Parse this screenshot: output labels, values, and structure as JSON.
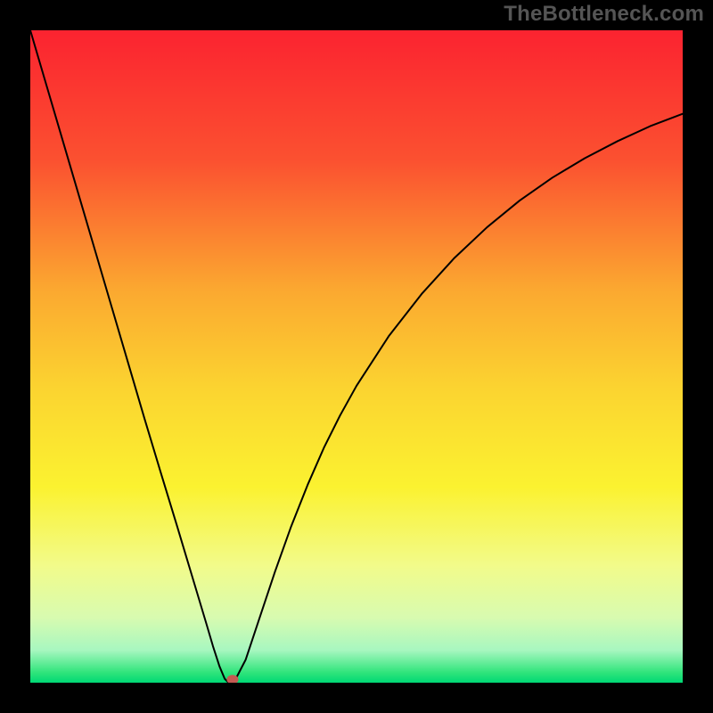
{
  "watermark": "TheBottleneck.com",
  "chart_data": {
    "type": "line",
    "title": "",
    "xlabel": "",
    "ylabel": "",
    "xlim": [
      0,
      100
    ],
    "ylim": [
      0,
      100
    ],
    "background_gradient": {
      "stops": [
        {
          "offset": 0.0,
          "color": "#fb2330"
        },
        {
          "offset": 0.2,
          "color": "#fb5130"
        },
        {
          "offset": 0.4,
          "color": "#fba930"
        },
        {
          "offset": 0.55,
          "color": "#fbd430"
        },
        {
          "offset": 0.7,
          "color": "#fbf230"
        },
        {
          "offset": 0.82,
          "color": "#f2fb8a"
        },
        {
          "offset": 0.9,
          "color": "#d8fbb0"
        },
        {
          "offset": 0.95,
          "color": "#a8f7c0"
        },
        {
          "offset": 0.985,
          "color": "#2ee47a"
        },
        {
          "offset": 1.0,
          "color": "#00d875"
        }
      ]
    },
    "series": [
      {
        "name": "bottleneck-curve",
        "color": "#000000",
        "width": 2,
        "x": [
          0.0,
          2.5,
          5.0,
          7.5,
          10.0,
          12.5,
          15.0,
          17.5,
          20.0,
          22.5,
          24.0,
          25.5,
          27.0,
          28.0,
          29.0,
          29.8,
          30.4,
          31.0,
          31.6,
          33.0,
          35.0,
          37.5,
          40.0,
          42.5,
          45.0,
          47.5,
          50.0,
          55.0,
          60.0,
          65.0,
          70.0,
          75.0,
          80.0,
          85.0,
          90.0,
          95.0,
          100.0
        ],
        "y": [
          100.0,
          91.5,
          83.0,
          74.5,
          66.0,
          57.5,
          49.0,
          40.5,
          32.2,
          24.0,
          19.0,
          14.0,
          9.0,
          5.6,
          2.5,
          0.6,
          0.0,
          0.0,
          0.8,
          3.5,
          9.5,
          17.0,
          24.0,
          30.3,
          36.0,
          41.0,
          45.5,
          53.2,
          59.6,
          65.1,
          69.8,
          73.9,
          77.4,
          80.4,
          83.0,
          85.3,
          87.2
        ]
      }
    ],
    "marker": {
      "name": "optimal-point",
      "x": 31.0,
      "y": 0.5,
      "rx": 0.9,
      "ry": 0.7,
      "color": "#c45a52"
    }
  }
}
